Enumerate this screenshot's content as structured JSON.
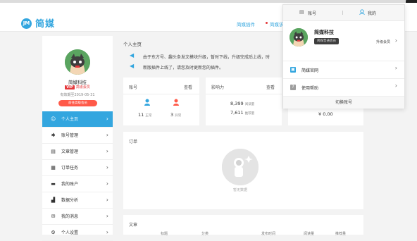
{
  "header": {
    "logo_letter": "JM",
    "brand": "简媒",
    "nav_plugin": "简媒插件",
    "nav_cut": "简媒该"
  },
  "sidebar": {
    "username": "简媒科技",
    "vip_badge": "VIP",
    "vip_text": "高级会员",
    "expiry": "有效期至2019-05-31",
    "upgrade_button": "前往高级会员",
    "items": [
      {
        "label": "个人主页",
        "icon": "user-icon",
        "glyph": "☺",
        "active": true
      },
      {
        "label": "账号管理",
        "icon": "asterisk-icon",
        "glyph": "✱",
        "active": false
      },
      {
        "label": "文章管理",
        "icon": "document-icon",
        "glyph": "▤",
        "active": false
      },
      {
        "label": "订单任务",
        "icon": "calendar-icon",
        "glyph": "▦",
        "active": false
      },
      {
        "label": "我的账户",
        "icon": "wallet-icon",
        "glyph": "▬",
        "active": false
      },
      {
        "label": "数据分析",
        "icon": "chart-icon",
        "glyph": "▟",
        "active": false
      },
      {
        "label": "我的消息",
        "icon": "message-icon",
        "glyph": "✉",
        "active": false
      },
      {
        "label": "个人设置",
        "icon": "settings-icon",
        "glyph": "⚙",
        "active": false
      }
    ]
  },
  "main": {
    "page_title": "个人主页",
    "notice_lines": [
      "由于东方号、趣头条发文模块升级，暂时下线，升级完成后上线，时",
      "新版插件上线了，请您及时更新您的插件。"
    ],
    "cards": {
      "account": {
        "title": "账号",
        "link": "查看",
        "normal_count": "11",
        "normal_label": "正常",
        "abnormal_count": "3",
        "abnormal_label": "异常"
      },
      "influence": {
        "title": "影响力",
        "link": "查看",
        "reads": "8,399",
        "reads_label": "阅读量",
        "recommends": "7,611",
        "recommends_label": "推荐量"
      },
      "balance": {
        "amount": "¥ 0.00"
      }
    },
    "orders_title": "订单",
    "empty_text": "暂无数据",
    "articles_title": "文章",
    "articles_headers": [
      "标题",
      "分类",
      "发布时间",
      "阅读量",
      "推荐量"
    ]
  },
  "panel": {
    "tab_account": "账号",
    "tab_mine": "我的",
    "name": "简媒科技",
    "member_badge": "简媒普通会员",
    "upgrade": "升级会员",
    "rows": [
      {
        "label": "简媒官网",
        "icon": "website-icon",
        "glyph": "▣",
        "color": "#33a6df"
      },
      {
        "label": "使用帮助",
        "icon": "help-icon",
        "glyph": "?",
        "color": "#9e9e9e"
      }
    ],
    "switch_account": "切换账号"
  },
  "colors": {
    "accent": "#33a6df",
    "danger": "#e4393c",
    "upgrade_button": "#ff5a49"
  }
}
